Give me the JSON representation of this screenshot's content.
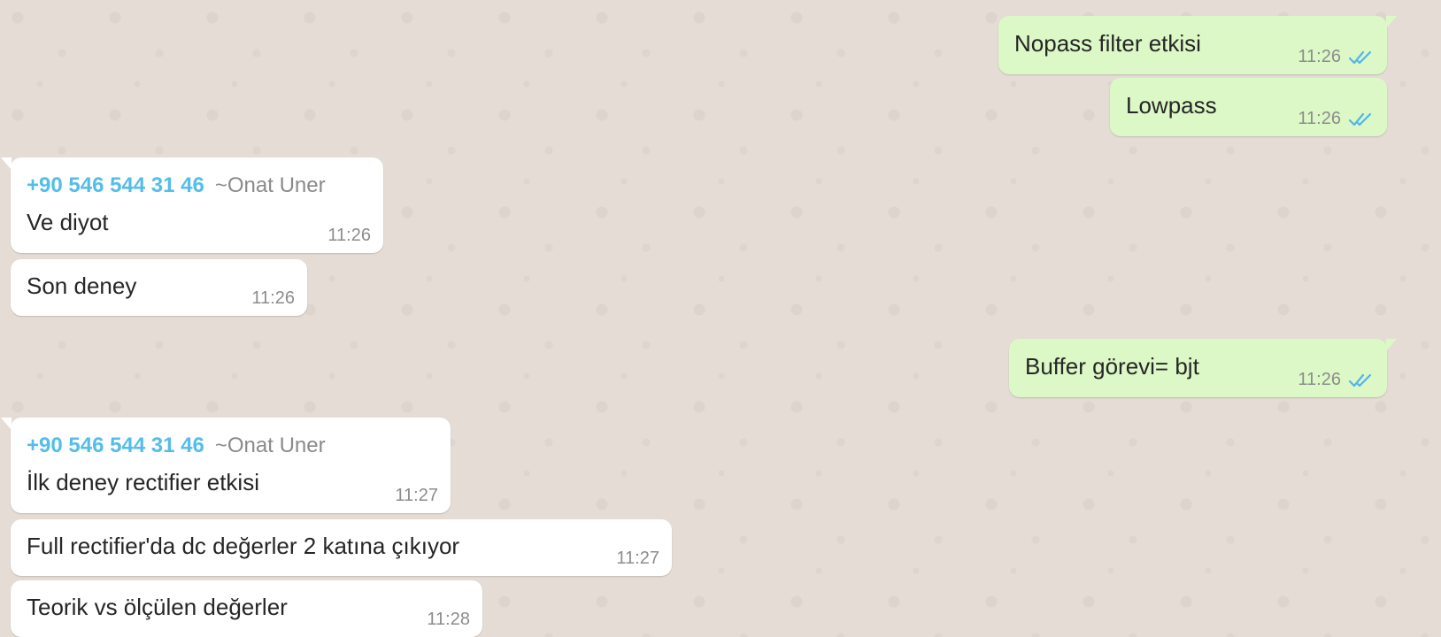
{
  "colors": {
    "background": "#e5ddd5",
    "incoming_bubble": "#ffffff",
    "outgoing_bubble": "#dcf8c6",
    "sender_phone": "#53bdeb",
    "sender_name": "#8a8a8a",
    "timestamp": "#8c8c8c",
    "read_ticks": "#4fb6ec"
  },
  "messages": [
    {
      "direction": "out",
      "text": "Nopass filter etkisi",
      "time": "11:26",
      "status_icon": "double-check-read-icon"
    },
    {
      "direction": "out",
      "text": "Lowpass",
      "time": "11:26",
      "status_icon": "double-check-read-icon"
    },
    {
      "direction": "in",
      "sender_phone": "+90 546 544 31 46",
      "sender_name": "~Onat Uner",
      "text": "Ve diyot",
      "time": "11:26"
    },
    {
      "direction": "in",
      "text": "Son deney",
      "time": "11:26"
    },
    {
      "direction": "out",
      "text": "Buffer görevi= bjt",
      "time": "11:26",
      "status_icon": "double-check-read-icon"
    },
    {
      "direction": "in",
      "sender_phone": "+90 546 544 31 46",
      "sender_name": "~Onat Uner",
      "text": "İlk deney rectifier etkisi",
      "time": "11:27"
    },
    {
      "direction": "in",
      "text": "Full rectifier'da dc değerler 2 katına çıkıyor",
      "time": "11:27"
    },
    {
      "direction": "in",
      "text": "Teorik vs ölçülen değerler",
      "time": "11:28"
    }
  ]
}
